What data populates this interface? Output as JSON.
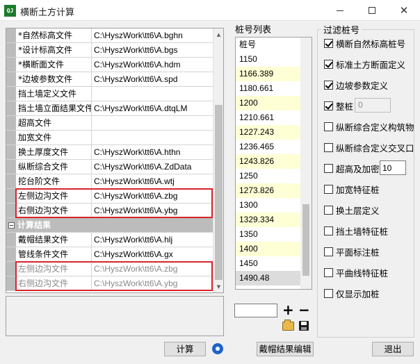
{
  "window": {
    "title": "横断土方计算",
    "app_icon": "app-logo-icon",
    "icon_text": "QJ"
  },
  "property_grid": {
    "input_rows": [
      {
        "name": "*自然标高文件",
        "value": "C:\\HyszWork\\tt6\\A.bghn"
      },
      {
        "name": "*设计标高文件",
        "value": "C:\\HyszWork\\tt6\\A.bgs"
      },
      {
        "name": "*横断面文件",
        "value": "C:\\HyszWork\\tt6\\A.hdm"
      },
      {
        "name": "*边坡参数文件",
        "value": "C:\\HyszWork\\tt6\\A.spd"
      },
      {
        "name": "挡土墙定义文件",
        "value": ""
      },
      {
        "name": "挡土墙立面结果文件",
        "value": "C:\\HyszWork\\tt6\\A.dtqLM"
      },
      {
        "name": "超高文件",
        "value": ""
      },
      {
        "name": "加宽文件",
        "value": ""
      },
      {
        "name": "换土厚度文件",
        "value": "C:\\HyszWork\\tt6\\A.hthn"
      },
      {
        "name": "纵断综合文件",
        "value": "C:\\HyszWork\\tt6\\A.ZdData"
      },
      {
        "name": "挖台阶文件",
        "value": "C:\\HyszWork\\tt6\\A.wtj"
      },
      {
        "name": "左侧边沟文件",
        "value": "C:\\HyszWork\\tt6\\A.zbg"
      },
      {
        "name": "右侧边沟文件",
        "value": "C:\\HyszWork\\tt6\\A.ybg"
      }
    ],
    "category_label": "计算结果",
    "result_rows": [
      {
        "name": "戴帽结果文件",
        "value": "C:\\HyszWork\\tt6\\A.hlj"
      },
      {
        "name": "管线条件文件",
        "value": "C:\\HyszWork\\tt6\\A.gx"
      },
      {
        "name": "左侧边沟文件",
        "value": "C:\\HyszWork\\tt6\\A.zbg"
      },
      {
        "name": "右侧边沟文件",
        "value": "C:\\HyszWork\\tt6\\A.ybg"
      }
    ]
  },
  "station_list": {
    "title": "桩号列表",
    "header": "桩号",
    "items": [
      "1150",
      "1166.389",
      "1180.661",
      "1200",
      "1210.661",
      "1227.243",
      "1236.465",
      "1243.826",
      "1250",
      "1273.826",
      "1300",
      "1329.334",
      "1350",
      "1400",
      "1450",
      "1490.48"
    ],
    "input_value": ""
  },
  "filter": {
    "title": "过滤桩号",
    "options": [
      {
        "label": "横断自然标高桩号",
        "checked": true
      },
      {
        "label": "标准土方断面定义",
        "checked": true
      },
      {
        "label": "边坡参数定义",
        "checked": true
      },
      {
        "label": "整桩",
        "checked": true
      },
      {
        "label": "纵断综合定义构筑物",
        "checked": false
      },
      {
        "label": "纵断综合定义交叉口",
        "checked": false
      },
      {
        "label": "超高及加密",
        "checked": false
      },
      {
        "label": "加宽特征桩",
        "checked": false
      },
      {
        "label": "换土层定义",
        "checked": false
      },
      {
        "label": "挡土墙特征桩",
        "checked": false
      },
      {
        "label": "平面标注桩",
        "checked": false
      },
      {
        "label": "平曲线特征桩",
        "checked": false
      },
      {
        "label": "仅显示加桩",
        "checked": false
      }
    ],
    "zheng_value": "0",
    "super_value": "10"
  },
  "buttons": {
    "calc": "计算",
    "edit": "戴帽结果编辑",
    "exit": "退出"
  }
}
